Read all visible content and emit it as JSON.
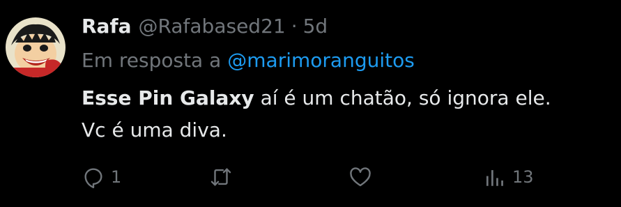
{
  "tweet": {
    "author": {
      "name": "Rafa",
      "handle": "@Rafabased21",
      "separator": "·",
      "time": "5d",
      "avatar_icon": "avatar-cartoon-icon"
    },
    "reply_context": {
      "prefix": "Em resposta a",
      "mention": "@marimoranguitos"
    },
    "body": {
      "bold": "Esse Pin Galaxy",
      "line1_rest": " aí é um chatão, só ignora ele.",
      "line2": "Vc é uma diva."
    },
    "actions": {
      "replies": "1",
      "retweets": "",
      "likes": "",
      "views": "13"
    }
  },
  "colors": {
    "background": "#000000",
    "primary_text": "#e7e9ea",
    "secondary_text": "#71767b",
    "link": "#1d9bf0"
  }
}
